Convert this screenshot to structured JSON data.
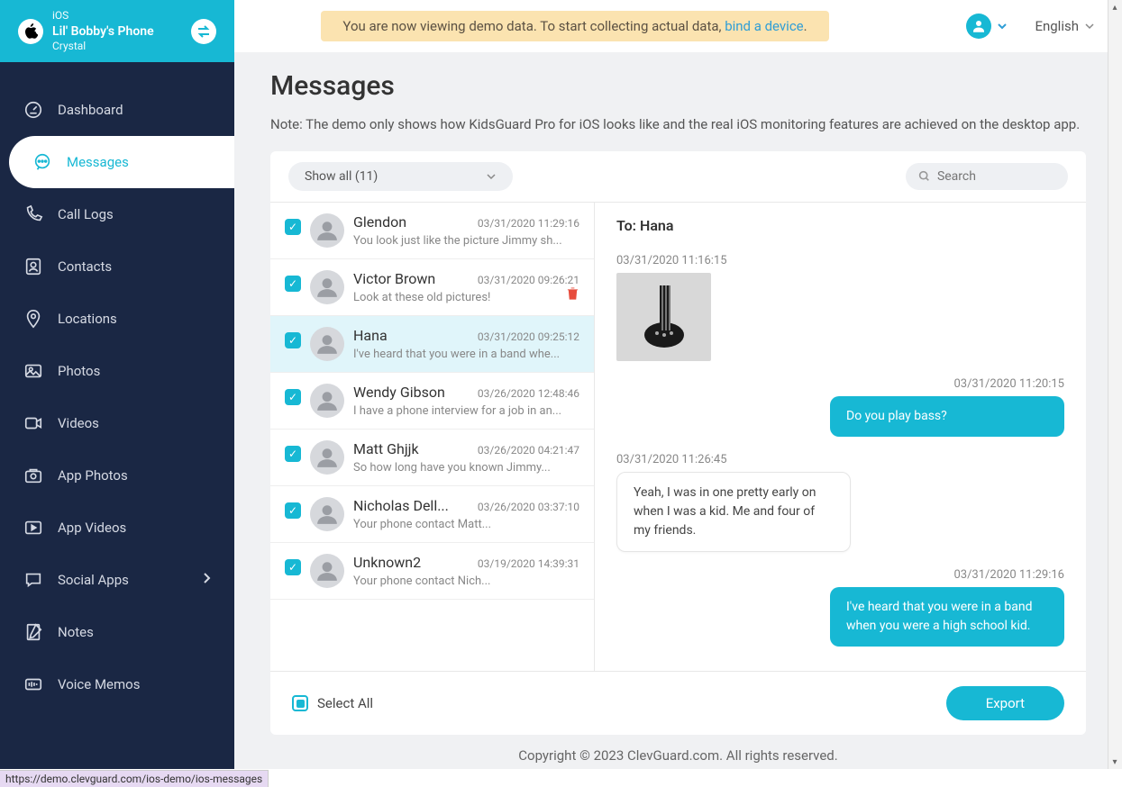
{
  "device": {
    "os": "iOS",
    "name": "Lil' Bobby's Phone",
    "sub": "Crystal"
  },
  "banner": {
    "prefix": "You are now viewing demo data. To start collecting actual data, ",
    "link": "bind a device",
    "suffix": "."
  },
  "language": "English",
  "nav": [
    {
      "label": "Dashboard",
      "icon": "dashboard"
    },
    {
      "label": "Messages",
      "icon": "messages",
      "active": true
    },
    {
      "label": "Call Logs",
      "icon": "call"
    },
    {
      "label": "Contacts",
      "icon": "contacts"
    },
    {
      "label": "Locations",
      "icon": "location"
    },
    {
      "label": "Photos",
      "icon": "photos"
    },
    {
      "label": "Videos",
      "icon": "videos"
    },
    {
      "label": "App Photos",
      "icon": "appphotos"
    },
    {
      "label": "App Videos",
      "icon": "appvideos"
    },
    {
      "label": "Social Apps",
      "icon": "social",
      "chev": true
    },
    {
      "label": "Notes",
      "icon": "notes"
    },
    {
      "label": "Voice Memos",
      "icon": "voice"
    }
  ],
  "page": {
    "title": "Messages",
    "note": "Note: The demo only shows how KidsGuard Pro for iOS looks like and the real iOS monitoring features are achieved on the desktop app."
  },
  "filter": {
    "label": "Show all (11)"
  },
  "search_placeholder": "Search",
  "conversations": [
    {
      "name": "Glendon",
      "time": "03/31/2020  11:29:16",
      "preview": "You look just like the picture Jimmy sh..."
    },
    {
      "name": "Victor Brown",
      "time": "03/31/2020  09:26:21",
      "preview": "Look at these old pictures!",
      "trash": true
    },
    {
      "name": "Hana",
      "time": "03/31/2020  09:25:12",
      "preview": "I've heard that you were in a band whe...",
      "active": true
    },
    {
      "name": "Wendy Gibson",
      "time": "03/26/2020  12:48:46",
      "preview": "I have a phone interview for a job in an..."
    },
    {
      "name": "Matt Ghjjk",
      "time": "03/26/2020  04:21:47",
      "preview": "So how long have you known Jimmy..."
    },
    {
      "name": "Nicholas Dell...",
      "time": "03/26/2020  03:37:10",
      "preview": "Your phone contact Matt..."
    },
    {
      "name": "Unknown2",
      "time": "03/19/2020  14:39:31",
      "preview": "Your phone contact Nich..."
    }
  ],
  "chat": {
    "to_label": "To: Hana",
    "messages": [
      {
        "side": "in",
        "ts": "03/31/2020  11:16:15",
        "type": "image"
      },
      {
        "side": "out",
        "ts": "03/31/2020  11:20:15",
        "text": "Do you play bass?"
      },
      {
        "side": "in",
        "ts": "03/31/2020  11:26:45",
        "text": "Yeah, I was in one pretty early on when I was a kid. Me and four of my friends."
      },
      {
        "side": "out",
        "ts": "03/31/2020  11:29:16",
        "text": "I've heard that you were in a band when you were a high school kid."
      }
    ]
  },
  "footer": {
    "select_all": "Select All",
    "export": "Export"
  },
  "copyright": "Copyright © 2023 ClevGuard.com. All rights reserved.",
  "statusbar": "https://demo.clevguard.com/ios-demo/ios-messages"
}
